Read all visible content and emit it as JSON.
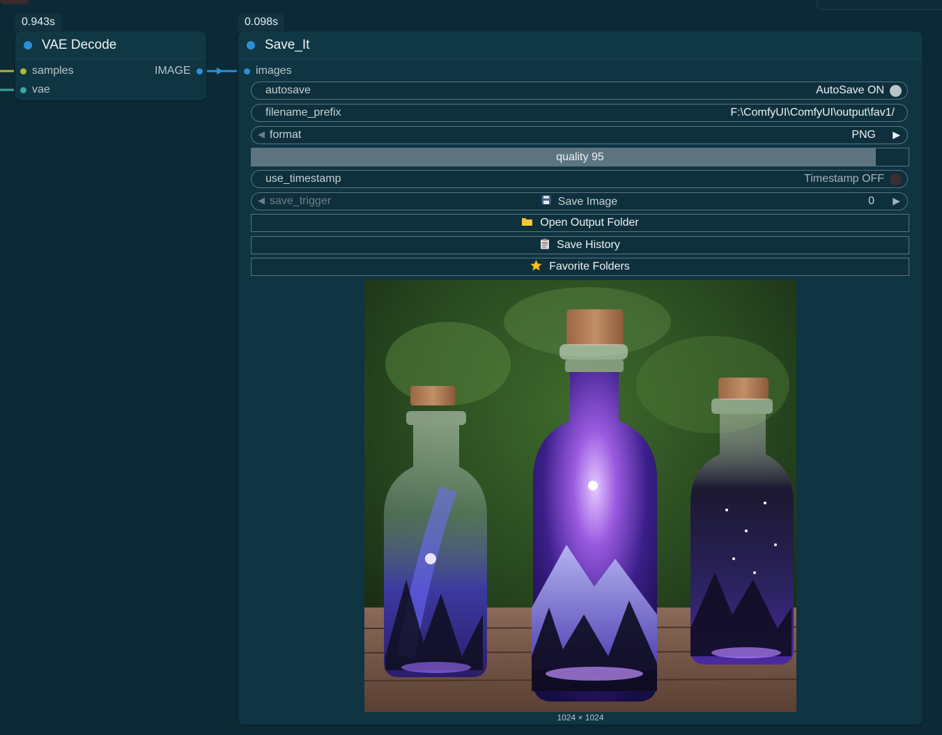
{
  "vae_node": {
    "time": "0.943s",
    "title": "VAE Decode",
    "inputs": [
      "samples",
      "vae"
    ],
    "output": "IMAGE"
  },
  "save_node": {
    "time": "0.098s",
    "title": "Save_It",
    "input": "images",
    "autosave": {
      "label": "autosave",
      "value": "AutoSave ON"
    },
    "filename_prefix": {
      "label": "filename_prefix",
      "value": "F:\\ComfyUI\\ComfyUI\\output\\fav1/"
    },
    "format": {
      "label": "format",
      "value": "PNG"
    },
    "quality": {
      "label": "quality",
      "value": 95,
      "text": "quality  95"
    },
    "use_timestamp": {
      "label": "use_timestamp",
      "value": "Timestamp OFF"
    },
    "save_trigger": {
      "label": "save_trigger",
      "button": "Save Image",
      "value": "0"
    },
    "buttons": {
      "open_folder": "Open Output Folder",
      "save_history": "Save History",
      "favorite_folders": "Favorite Folders"
    },
    "preview_dims": "1024 × 1024"
  },
  "colors": {
    "canvas": "#0c2a36",
    "node": "#0f3442",
    "accent": "#2b8fd6",
    "samples_link": "#b5b52a",
    "vae_link": "#3aa8a0"
  },
  "icons": [
    "floppy-icon",
    "folder-icon",
    "clipboard-icon",
    "star-icon"
  ]
}
